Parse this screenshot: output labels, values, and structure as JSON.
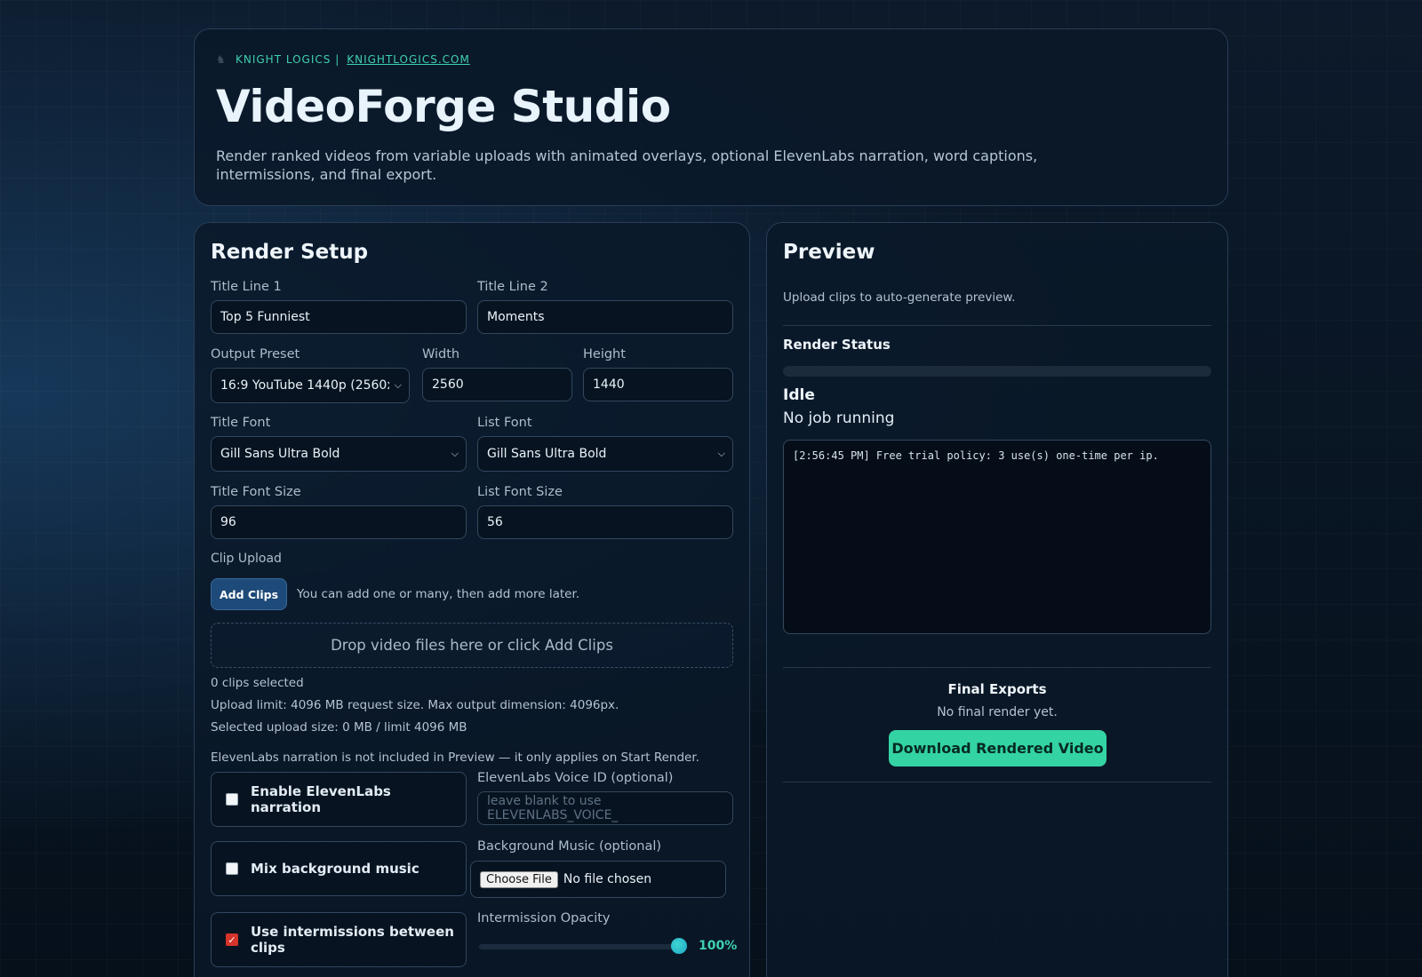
{
  "header": {
    "brand_name": "KNIGHT LOGICS |",
    "brand_link": "KNIGHTLOGICS.COM",
    "title": "VideoForge Studio",
    "subtitle": "Render ranked videos from variable uploads with animated overlays, optional ElevenLabs narration, word captions, intermissions, and final export."
  },
  "setup": {
    "title": "Render Setup",
    "title_line1": {
      "label": "Title Line 1",
      "value": "Top 5 Funniest"
    },
    "title_line2": {
      "label": "Title Line 2",
      "value": "Moments"
    },
    "output_preset": {
      "label": "Output Preset",
      "value": "16:9 YouTube 1440p (2560x"
    },
    "width": {
      "label": "Width",
      "value": "2560"
    },
    "height": {
      "label": "Height",
      "value": "1440"
    },
    "title_font": {
      "label": "Title Font",
      "value": "Gill Sans Ultra Bold"
    },
    "list_font": {
      "label": "List Font",
      "value": "Gill Sans Ultra Bold"
    },
    "title_font_size": {
      "label": "Title Font Size",
      "value": "96"
    },
    "list_font_size": {
      "label": "List Font Size",
      "value": "56"
    },
    "clip_upload": {
      "label": "Clip Upload",
      "button": "Add Clips",
      "hint": "You can add one or many, then add more later.",
      "dropzone": "Drop video files here or click Add Clips"
    },
    "clips_selected": "0 clips selected",
    "upload_limit": "Upload limit: 4096 MB request size. Max output dimension: 4096px.",
    "upload_size": "Selected upload size: 0 MB / limit 4096 MB",
    "narration_note": "ElevenLabs narration is not included in Preview — it only applies on Start Render.",
    "options": {
      "enable_narration": {
        "label": "Enable ElevenLabs narration",
        "checked": false
      },
      "mix_music": {
        "label": "Mix background music",
        "checked": false
      },
      "intermissions": {
        "label": "Use intermissions between clips",
        "checked": true
      }
    },
    "voice_id": {
      "label": "ElevenLabs Voice ID (optional)",
      "placeholder": "leave blank to use ELEVENLABS_VOICE_"
    },
    "background_music": {
      "label": "Background Music (optional)",
      "button": "Choose File",
      "status": "No file chosen"
    },
    "intermission_opacity": {
      "label": "Intermission Opacity",
      "value": "100%",
      "fraction": 1.0
    }
  },
  "preview": {
    "title": "Preview",
    "note": "Upload clips to auto-generate preview.",
    "render_status_title": "Render Status",
    "progress_fraction": 0,
    "state": "Idle",
    "job": "No job running",
    "log": "[2:56:45 PM] Free trial policy: 3 use(s) one-time per ip.",
    "exports_title": "Final Exports",
    "exports_note": "No final render yet.",
    "download_button": "Download Rendered Video"
  },
  "colors": {
    "accent": "#33d3a4",
    "brand_text": "#3fd0b0",
    "add_button": "#1d4a78",
    "checkbox_checked": "#d6342b"
  }
}
